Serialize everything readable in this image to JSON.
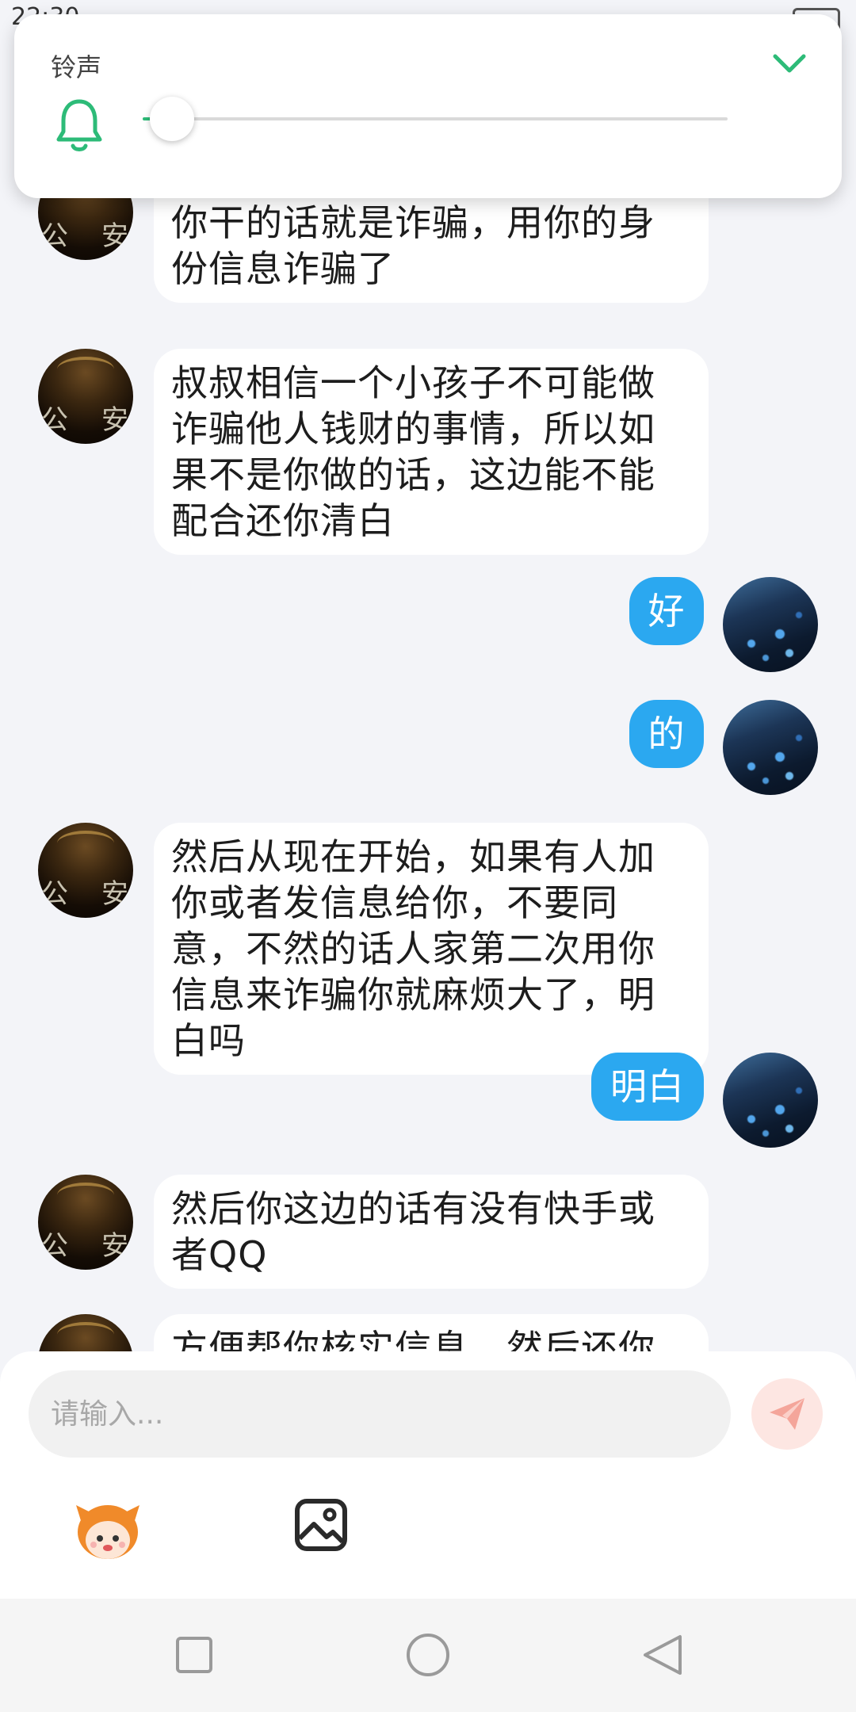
{
  "status_bar": {
    "time_partial": "22:30"
  },
  "volume_panel": {
    "title": "铃声",
    "level_fraction": 0.05,
    "accent_color": "#2dbb78",
    "icons": {
      "bell": "bell-icon",
      "collapse": "chevron-down-icon"
    }
  },
  "messages": [
    {
      "side": "left",
      "text": "我跟你说，如果这个事情不是你干的话就是诈骗，用你的身份信息诈骗了"
    },
    {
      "side": "left",
      "text": "叔叔相信一个小孩子不可能做诈骗他人钱财的事情，所以如果不是你做的话，这边能不能配合还你清白"
    },
    {
      "side": "right",
      "text": "好"
    },
    {
      "side": "right",
      "text": "的"
    },
    {
      "side": "left",
      "text": "然后从现在开始，如果有人加你或者发信息给你，不要同意，不然的话人家第二次用你信息来诈骗你就麻烦大了，明白吗"
    },
    {
      "side": "right",
      "text": "明白"
    },
    {
      "side": "left",
      "text": "然后你这边的话有没有快手或者QQ"
    },
    {
      "side": "left",
      "text": "方便帮你核实信息，然后还你清"
    }
  ],
  "input": {
    "placeholder": "请输入...",
    "value": ""
  },
  "toolbar": {
    "send_icon": "send-icon",
    "emoji_icon": "cartoon-face-icon",
    "image_icon": "image-icon"
  },
  "nav": {
    "recent_icon": "square-icon",
    "home_icon": "circle-icon",
    "back_icon": "triangle-back-icon"
  },
  "colors": {
    "bubble_right": "#2ba8f0",
    "bubble_left": "#ffffff",
    "background": "#f3f4f8"
  }
}
